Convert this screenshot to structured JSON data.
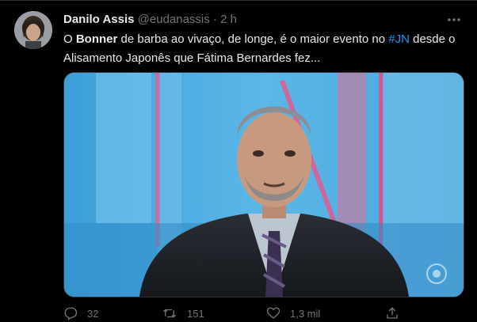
{
  "tweet": {
    "author_name": "Danilo Assis",
    "author_handle": "@eudanassis",
    "separator": "·",
    "time": "2 h",
    "text_parts": [
      {
        "t": "O ",
        "k": "plain"
      },
      {
        "t": "Bonner",
        "k": "bold"
      },
      {
        "t": " de barba ao vivaço, de longe, é o maior evento no ",
        "k": "plain"
      },
      {
        "t": "#JN",
        "k": "hashtag"
      },
      {
        "t": " desde o Alisamento Japonês que Fátima Bernardes fez...",
        "k": "plain"
      }
    ],
    "media_icon": "news-anchor-photo"
  },
  "actions": {
    "replies": "32",
    "retweets": "151",
    "likes": "1,3 mil",
    "reply_icon": "reply-icon",
    "retweet_icon": "retweet-icon",
    "like_icon": "heart-icon",
    "share_icon": "share-icon"
  },
  "colors": {
    "background": "#000000",
    "text": "#e7e9ea",
    "muted": "#71767b",
    "accent": "#1d9bf0"
  }
}
